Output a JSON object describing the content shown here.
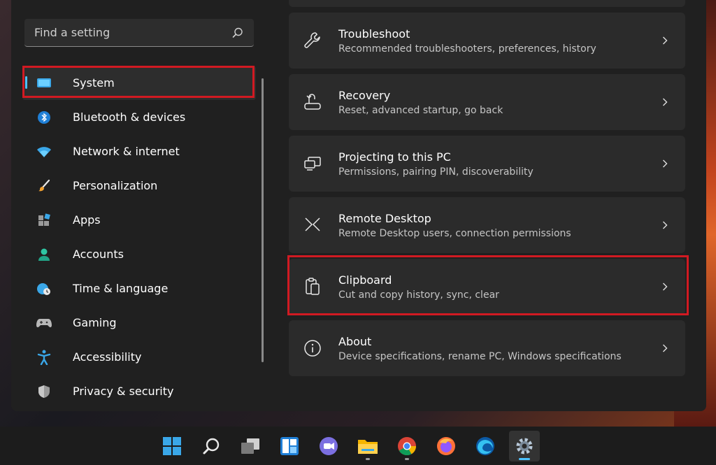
{
  "search": {
    "placeholder": "Find a setting",
    "icon": "search-icon"
  },
  "sidebar": {
    "items": [
      {
        "label": "System",
        "icon": "monitor-icon",
        "selected": true
      },
      {
        "label": "Bluetooth & devices",
        "icon": "bluetooth-icon"
      },
      {
        "label": "Network & internet",
        "icon": "wifi-icon"
      },
      {
        "label": "Personalization",
        "icon": "brush-icon"
      },
      {
        "label": "Apps",
        "icon": "apps-icon"
      },
      {
        "label": "Accounts",
        "icon": "person-icon"
      },
      {
        "label": "Time & language",
        "icon": "globe-clock-icon"
      },
      {
        "label": "Gaming",
        "icon": "gamepad-icon"
      },
      {
        "label": "Accessibility",
        "icon": "accessibility-icon"
      },
      {
        "label": "Privacy & security",
        "icon": "shield-icon"
      }
    ]
  },
  "content": {
    "cards": [
      {
        "title": "Troubleshoot",
        "subtitle": "Recommended troubleshooters, preferences, history",
        "icon": "wrench-icon"
      },
      {
        "title": "Recovery",
        "subtitle": "Reset, advanced startup, go back",
        "icon": "recovery-icon"
      },
      {
        "title": "Projecting to this PC",
        "subtitle": "Permissions, pairing PIN, discoverability",
        "icon": "projecting-icon"
      },
      {
        "title": "Remote Desktop",
        "subtitle": "Remote Desktop users, connection permissions",
        "icon": "remote-desktop-icon"
      },
      {
        "title": "Clipboard",
        "subtitle": "Cut and copy history, sync, clear",
        "icon": "clipboard-icon",
        "highlighted": true
      },
      {
        "title": "About",
        "subtitle": "Device specifications, rename PC, Windows specifications",
        "icon": "info-icon"
      }
    ]
  },
  "taskbar": {
    "apps": [
      "windows-start-icon",
      "search-icon",
      "task-view-icon",
      "widgets-icon",
      "chat-icon",
      "file-explorer-icon",
      "chrome-icon",
      "firefox-icon",
      "edge-icon",
      "settings-icon"
    ],
    "active_app": "settings-icon"
  },
  "colors": {
    "accent": "#4cc2ff",
    "highlight": "#d11a22"
  }
}
